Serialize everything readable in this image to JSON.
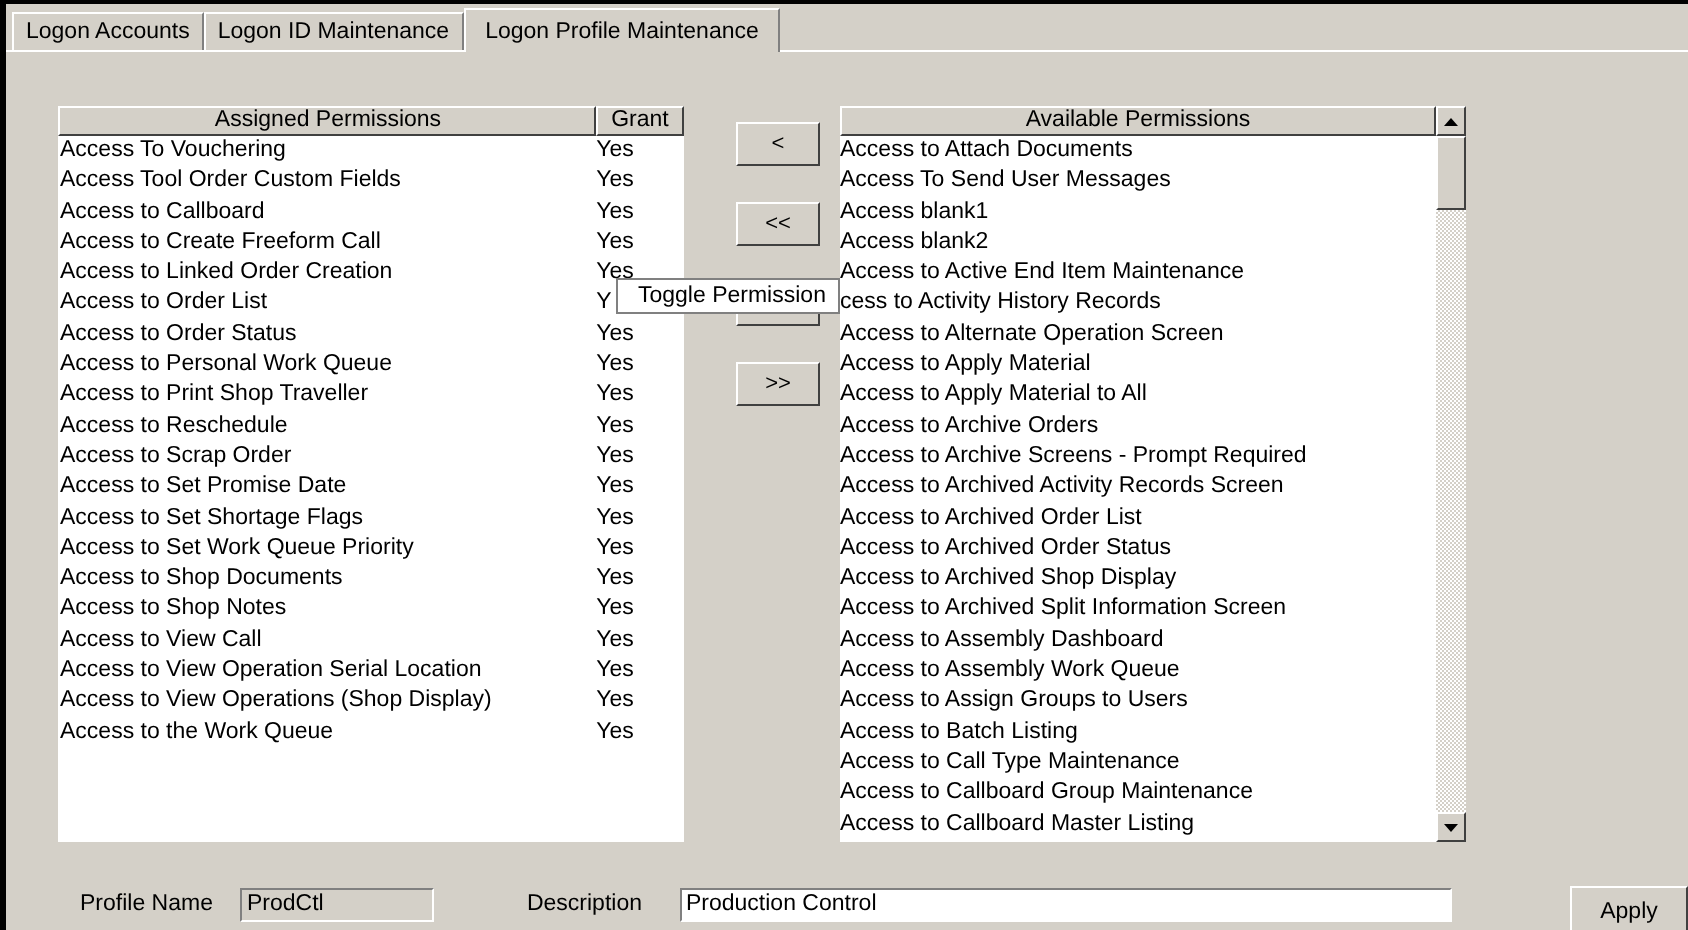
{
  "tabs": [
    {
      "label": "Logon Accounts",
      "selected": false
    },
    {
      "label": "Logon ID Maintenance",
      "selected": false
    },
    {
      "label": "Logon Profile Maintenance",
      "selected": true
    }
  ],
  "assigned": {
    "columns": [
      "Assigned Permissions",
      "Grant"
    ],
    "rows": [
      {
        "name": "Access To Vouchering",
        "grant": "Yes"
      },
      {
        "name": "Access Tool Order Custom Fields",
        "grant": "Yes"
      },
      {
        "name": "Access to Callboard",
        "grant": "Yes"
      },
      {
        "name": "Access to Create Freeform Call",
        "grant": "Yes"
      },
      {
        "name": "Access to Linked Order Creation",
        "grant": "Yes"
      },
      {
        "name": "Access to Order List",
        "grant": "Y"
      },
      {
        "name": "Access to Order Status",
        "grant": "Yes"
      },
      {
        "name": "Access to Personal Work Queue",
        "grant": "Yes"
      },
      {
        "name": "Access to Print Shop Traveller",
        "grant": "Yes"
      },
      {
        "name": "Access to Reschedule",
        "grant": "Yes"
      },
      {
        "name": "Access to Scrap Order",
        "grant": "Yes"
      },
      {
        "name": "Access to Set Promise Date",
        "grant": "Yes"
      },
      {
        "name": "Access to Set Shortage Flags",
        "grant": "Yes"
      },
      {
        "name": "Access to Set Work Queue Priority",
        "grant": "Yes"
      },
      {
        "name": "Access to Shop Documents",
        "grant": "Yes"
      },
      {
        "name": "Access to Shop Notes",
        "grant": "Yes"
      },
      {
        "name": "Access to View Call",
        "grant": "Yes"
      },
      {
        "name": "Access to View Operation Serial Location",
        "grant": "Yes"
      },
      {
        "name": "Access to View Operations (Shop Display)",
        "grant": "Yes"
      },
      {
        "name": "Access to the Work Queue",
        "grant": "Yes"
      }
    ]
  },
  "move_buttons": [
    {
      "kind": "labeled",
      "label": "<"
    },
    {
      "kind": "labeled",
      "label": "<<"
    },
    {
      "kind": "covered"
    },
    {
      "kind": "labeled",
      "label": ">>"
    }
  ],
  "available": {
    "header": "Available Permissions",
    "items": [
      "Access  to Attach Documents",
      "Access To Send User Messages",
      "Access blank1",
      "Access blank2",
      "Access to Active End Item Maintenance",
      "cess to Activity History Records",
      "Access to Alternate Operation Screen",
      "Access to Apply Material",
      "Access to Apply Material to All",
      "Access to Archive Orders",
      "Access to Archive Screens - Prompt Required",
      "Access to Archived Activity Records Screen",
      "Access to Archived Order List",
      "Access to Archived Order Status",
      "Access to Archived Shop Display",
      "Access to Archived Split Information Screen",
      "Access to Assembly Dashboard",
      "Access to Assembly Work Queue",
      "Access to Assign Groups to Users",
      "Access to Batch Listing",
      "Access to Call Type Maintenance",
      "Access to Callboard Group Maintenance",
      "Access to Callboard Master Listing"
    ]
  },
  "context_menu": {
    "items": [
      "Toggle Permission"
    ]
  },
  "footer": {
    "profile_name_label": "Profile Name",
    "profile_name": "ProdCtl",
    "description_label": "Description",
    "description": "Production Control",
    "apply": "Apply"
  }
}
